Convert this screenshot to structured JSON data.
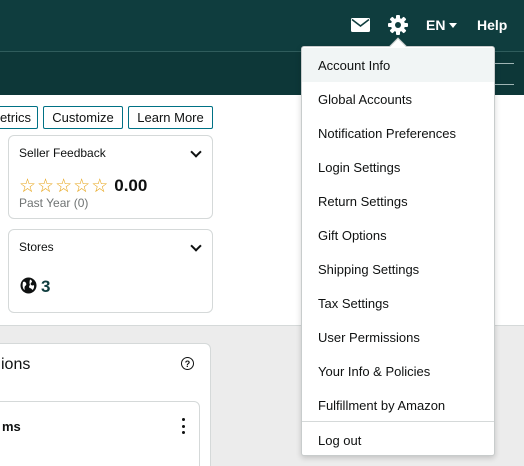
{
  "header": {
    "mail_icon": "mail-icon",
    "settings_icon": "gear-icon",
    "language": "EN",
    "help_label": "Help"
  },
  "toolbar": {
    "metrics_label": "etrics",
    "customize_label": "Customize",
    "learn_more_label": "Learn More"
  },
  "seller_feedback": {
    "title": "Seller Feedback",
    "rating": "0.00",
    "stars": 0,
    "period": "Past Year (0)"
  },
  "stores": {
    "title": "Stores",
    "count": "3"
  },
  "bottom_card": {
    "title": "ions",
    "inner_title": "ms"
  },
  "settings_menu": {
    "items": [
      "Account Info",
      "Global Accounts",
      "Notification Preferences",
      "Login Settings",
      "Return Settings",
      "Gift Options",
      "Shipping Settings",
      "Tax Settings",
      "User Permissions",
      "Your Info & Policies",
      "Fulfillment by Amazon"
    ],
    "logout_label": "Log out"
  },
  "colors": {
    "header_bg": "#0f3d3e",
    "accent": "#007185",
    "star": "#e7a418"
  }
}
